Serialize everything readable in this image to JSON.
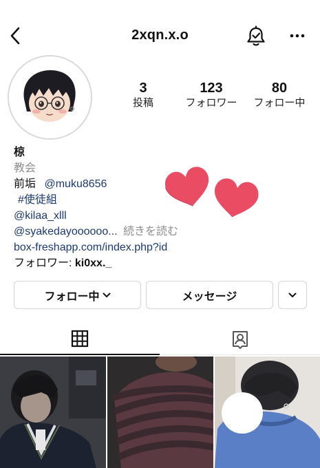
{
  "header": {
    "username": "2xqn.x.o"
  },
  "stats": [
    {
      "count": "3",
      "label": "投稿"
    },
    {
      "count": "123",
      "label": "フォロワー"
    },
    {
      "count": "80",
      "label": "フォロー中"
    }
  ],
  "bio": {
    "name": "椋",
    "category": "教会",
    "line_prefix": "前垢",
    "mention1": "@muku8656",
    "hashtag": "#使徒組",
    "mention2": "@kilaa_xlll",
    "mention3": "@syakedayoooooo...",
    "more_label": "続きを読む",
    "website": "box-freshapp.com/index.php?id",
    "followed_by_prefix": "フォロワー:",
    "followed_by_user": "ki0xx._"
  },
  "actions": {
    "follow_label": "フォロー中",
    "message_label": "メッセージ"
  },
  "colors": {
    "link": "#1b3a6e",
    "heart": "#ea4c63",
    "border": "#d4d4d4"
  }
}
